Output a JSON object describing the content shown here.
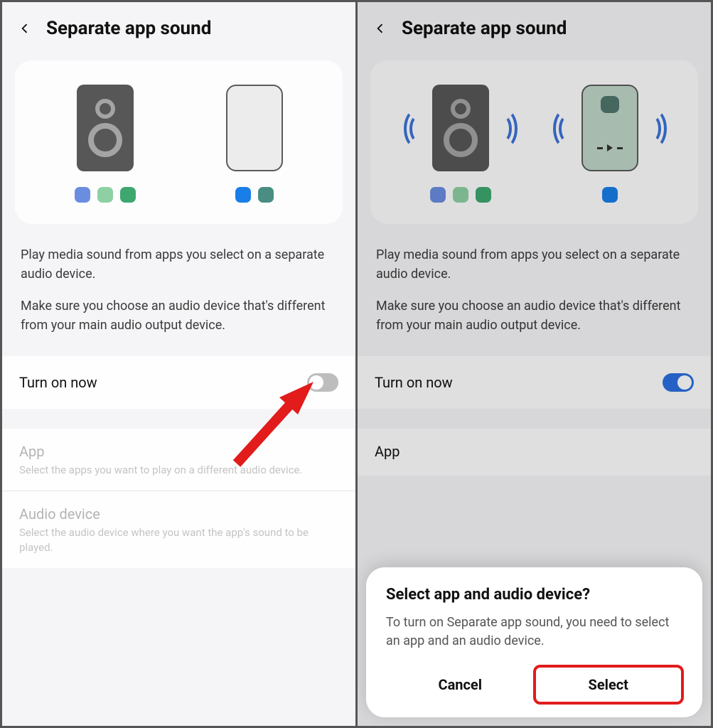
{
  "left": {
    "title": "Separate app sound",
    "description1": "Play media sound from apps you select on a separate audio device.",
    "description2": "Make sure you choose an audio device that's different from your main audio output device.",
    "toggle_label": "Turn on now",
    "toggle_state": "off",
    "settings": [
      {
        "title": "App",
        "desc": "Select the apps you want to play on a different audio device."
      },
      {
        "title": "Audio device",
        "desc": "Select the audio device where you want the app's sound to be played."
      }
    ]
  },
  "right": {
    "title": "Separate app sound",
    "description1": "Play media sound from apps you select on a separate audio device.",
    "description2": "Make sure you choose an audio device that's different from your main audio output device.",
    "toggle_label": "Turn on now",
    "toggle_state": "on",
    "settings": [
      {
        "title": "App"
      }
    ],
    "dialog": {
      "title": "Select app and audio device?",
      "body": "To turn on Separate app sound, you need to select an app and an audio device.",
      "cancel": "Cancel",
      "select": "Select"
    }
  }
}
